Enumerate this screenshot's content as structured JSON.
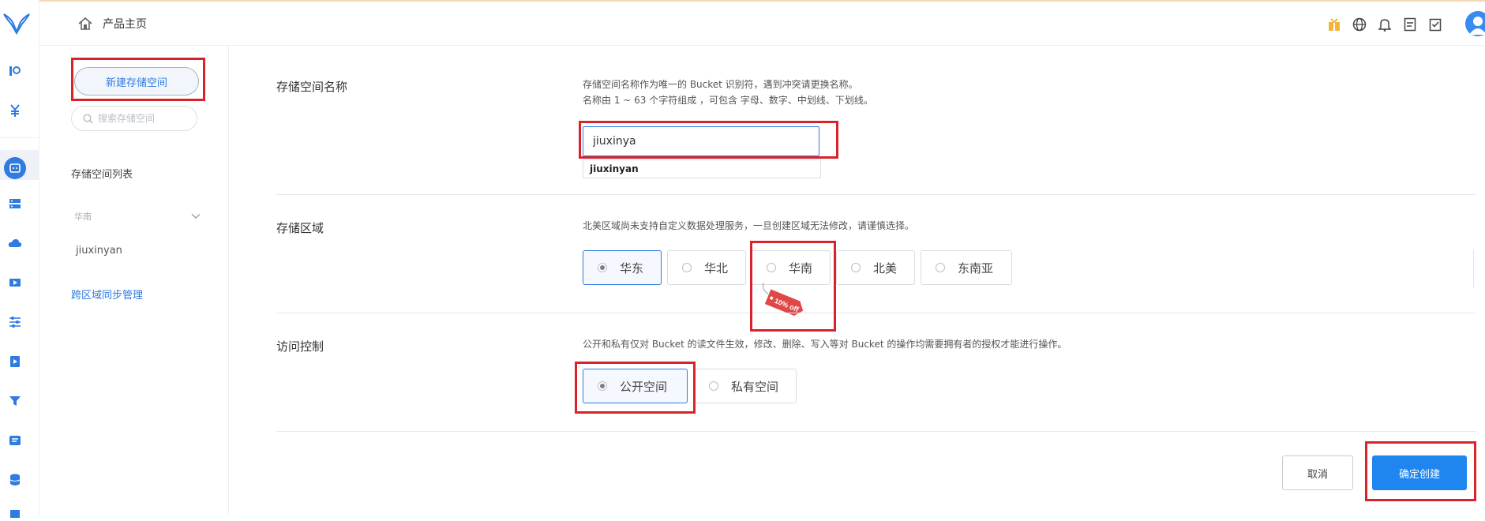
{
  "header": {
    "home_title": "产品主页",
    "icons": [
      "gift-icon",
      "globe-icon",
      "bell-icon",
      "document-icon",
      "checklist-icon"
    ]
  },
  "rail": {
    "icons": [
      "logo-icon",
      "dashboard-icon",
      "currency-icon",
      "storage-icon",
      "server-icon",
      "cloud-icon",
      "video-icon",
      "sliders-icon",
      "media-icon",
      "filter-icon",
      "message-icon",
      "database-icon"
    ]
  },
  "sidebar": {
    "new_bucket_button": "新建存储空间",
    "search_placeholder": "搜索存储空间",
    "list_title": "存储空间列表",
    "region": "华南",
    "buckets": [
      "jiuxinyan"
    ],
    "cross_region_link": "跨区域同步管理"
  },
  "form": {
    "name": {
      "label": "存储空间名称",
      "hint_line1": "存储空间名称作为唯一的 Bucket 识别符，遇到冲突请更换名称。",
      "hint_line2": "名称由 1 ~ 63 个字符组成 ，可包含 字母、数字、中划线、下划线。",
      "value": "jiuxinya",
      "suggestion": "jiuxinyan"
    },
    "region": {
      "label": "存储区域",
      "hint": "北美区域尚未支持自定义数据处理服务，一旦创建区域无法修改，请谨慎选择。",
      "options": [
        "华东",
        "华北",
        "华南",
        "北美",
        "东南亚"
      ],
      "selected": "华东",
      "discount_badge": "10% off"
    },
    "access": {
      "label": "访问控制",
      "hint": "公开和私有仅对 Bucket 的读文件生效，修改、删除、写入等对 Bucket 的操作均需要拥有者的授权才能进行操作。",
      "options": [
        "公开空间",
        "私有空间"
      ],
      "selected": "公开空间"
    }
  },
  "actions": {
    "cancel": "取消",
    "confirm": "确定创建"
  },
  "colors": {
    "accent": "#1f86f0",
    "highlight_box": "#d9222a",
    "badge": "#e04848"
  }
}
